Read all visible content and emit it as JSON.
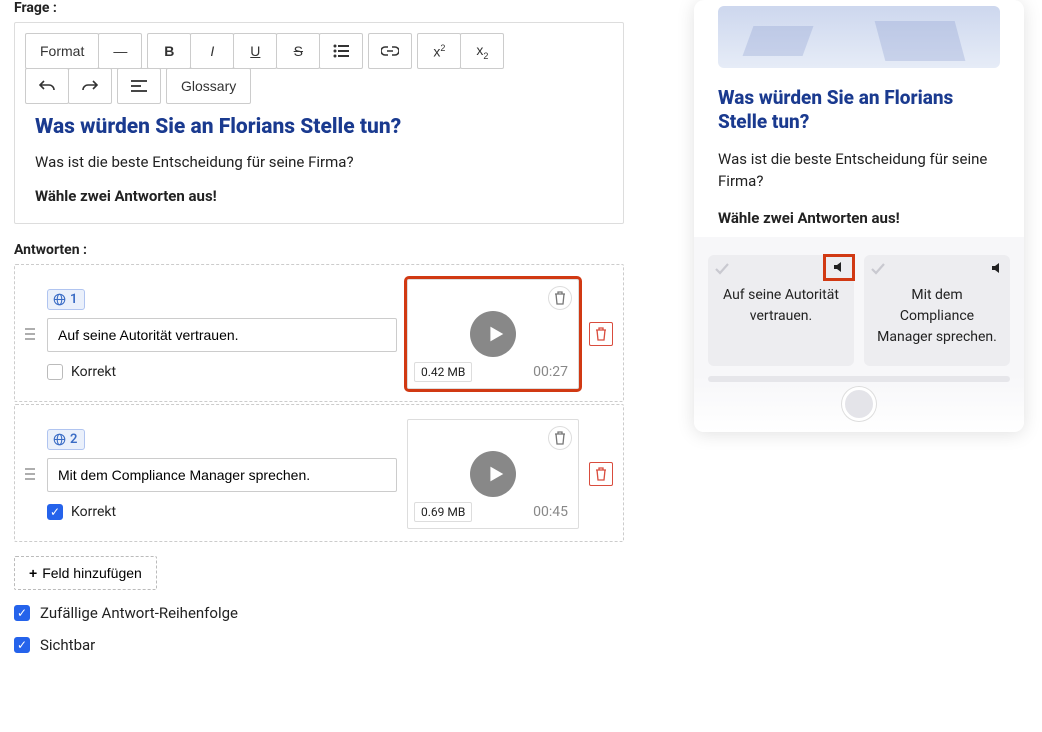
{
  "labels": {
    "question": "Frage :",
    "answers": "Antworten :"
  },
  "toolbar": {
    "format": "Format",
    "glossary": "Glossary"
  },
  "question": {
    "title": "Was würden Sie an Florians Stelle tun?",
    "text": "Was ist die beste Entscheidung für seine Firma?",
    "bold": "Wähle zwei Antworten aus!"
  },
  "answers": [
    {
      "lang_num": "1",
      "text": "Auf seine Autorität vertrauen.",
      "correct": false,
      "media": {
        "size": "0.42 MB",
        "duration": "00:27"
      },
      "highlight_media": true
    },
    {
      "lang_num": "2",
      "text": "Mit dem Compliance Manager sprechen.",
      "correct": true,
      "media": {
        "size": "0.69 MB",
        "duration": "00:45"
      },
      "highlight_media": false
    }
  ],
  "correct_label": "Korrekt",
  "add_field": "Feld hinzufügen",
  "options": {
    "random": "Zufällige Antwort-Reihenfolge",
    "visible": "Sichtbar"
  },
  "preview": {
    "title": "Was würden Sie an Florians Stelle tun?",
    "text": "Was ist die beste Entscheidung für seine Firma?",
    "bold": "Wähle zwei Antworten aus!",
    "answers": [
      {
        "text": "Auf seine Autorität vertrauen.",
        "sound_highlight": true
      },
      {
        "text": "Mit dem Compliance Manager sprechen.",
        "sound_highlight": false
      }
    ]
  }
}
